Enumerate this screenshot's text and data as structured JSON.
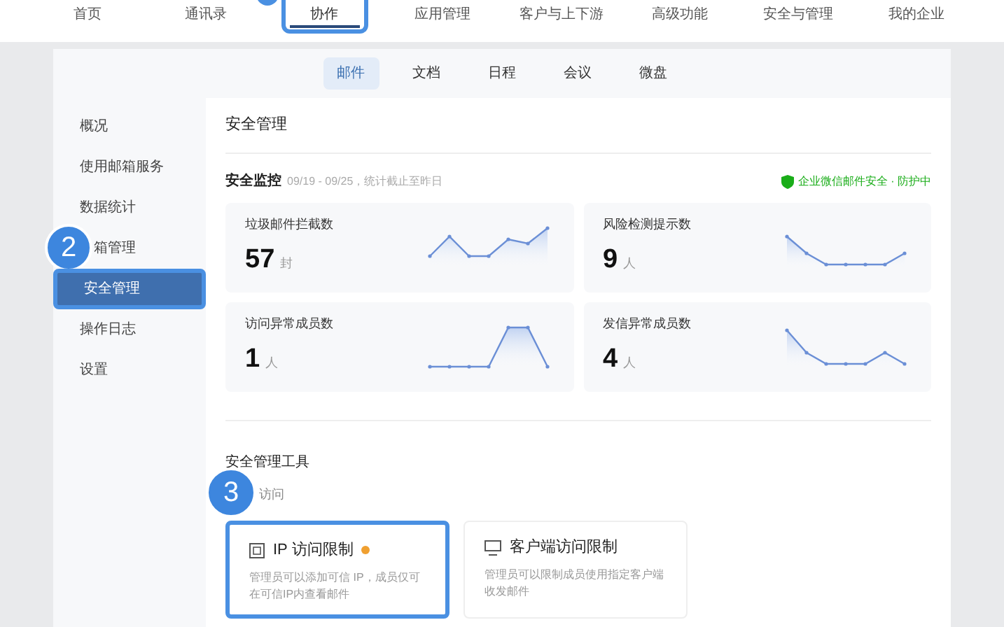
{
  "top_nav": [
    {
      "label": "首页",
      "selected": false,
      "highlighted": false,
      "step_marker": false
    },
    {
      "label": "通讯录",
      "selected": false,
      "highlighted": false,
      "step_marker": false
    },
    {
      "label": "协作",
      "selected": true,
      "highlighted": true,
      "step_marker": true
    },
    {
      "label": "应用管理",
      "selected": false,
      "highlighted": false,
      "step_marker": false
    },
    {
      "label": "客户与上下游",
      "selected": false,
      "highlighted": false,
      "step_marker": false
    },
    {
      "label": "高级功能",
      "selected": false,
      "highlighted": false,
      "step_marker": false
    },
    {
      "label": "安全与管理",
      "selected": false,
      "highlighted": false,
      "step_marker": false
    },
    {
      "label": "我的企业",
      "selected": false,
      "highlighted": false,
      "step_marker": false
    }
  ],
  "sub_tabs": [
    {
      "label": "邮件",
      "selected": true
    },
    {
      "label": "文档",
      "selected": false
    },
    {
      "label": "日程",
      "selected": false
    },
    {
      "label": "会议",
      "selected": false
    },
    {
      "label": "微盘",
      "selected": false
    }
  ],
  "sidebar": {
    "items": [
      {
        "label": "概况",
        "selected": false,
        "highlighted": false
      },
      {
        "label": "使用邮箱服务",
        "selected": false,
        "highlighted": false
      },
      {
        "label": "数据统计",
        "selected": false,
        "highlighted": false
      },
      {
        "label": "箱管理",
        "selected": false,
        "highlighted": false,
        "step_badge": "2"
      },
      {
        "label": "安全管理",
        "selected": true,
        "highlighted": true
      },
      {
        "label": "操作日志",
        "selected": false,
        "highlighted": false
      },
      {
        "label": "设置",
        "selected": false,
        "highlighted": false
      }
    ]
  },
  "page_title": "安全管理",
  "monitor": {
    "title": "安全监控",
    "subtitle": "09/19 - 09/25，统计截止至昨日",
    "status": "企业微信邮件安全 · 防护中",
    "cards": [
      {
        "label": "垃圾邮件拦截数",
        "value": "57",
        "unit": "封"
      },
      {
        "label": "风险检测提示数",
        "value": "9",
        "unit": "人"
      },
      {
        "label": "访问异常成员数",
        "value": "1",
        "unit": "人"
      },
      {
        "label": "发信异常成员数",
        "value": "4",
        "unit": "人"
      }
    ]
  },
  "tools": {
    "title": "安全管理工具",
    "group_label": "访问",
    "step_badge": "3",
    "cards": [
      {
        "kind": "ip",
        "title": "IP 访问限制",
        "new_mark": true,
        "highlighted": true,
        "description": "管理员可以添加可信 IP，成员仅可在可信IP内查看邮件"
      },
      {
        "kind": "client",
        "title": "客户端访问限制",
        "new_mark": false,
        "highlighted": false,
        "description": "管理员可以限制成员使用指定客户端收发邮件"
      }
    ]
  }
}
